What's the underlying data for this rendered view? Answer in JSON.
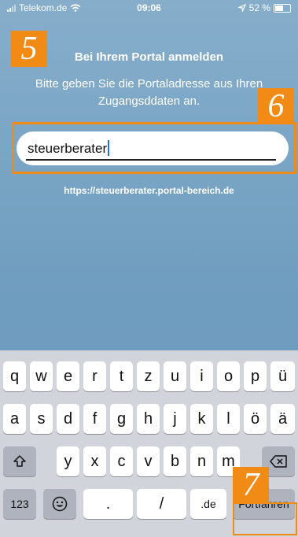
{
  "status_bar": {
    "carrier": "Telekom.de",
    "time": "09:06",
    "battery": "52 %"
  },
  "badges": {
    "step5": "5",
    "step6": "6",
    "step7": "7"
  },
  "login": {
    "title": "Bei Ihrem Portal anmelden",
    "subtitle": "Bitte geben Sie die Portaladresse aus Ihren Zugangsddaten an.",
    "input_value": "steuerberater",
    "url_preview": "https://steuerberater.portal-bereich.de"
  },
  "keyboard": {
    "row1": [
      "q",
      "w",
      "e",
      "r",
      "t",
      "z",
      "u",
      "i",
      "o",
      "p",
      "ü"
    ],
    "row2": [
      "a",
      "s",
      "d",
      "f",
      "g",
      "h",
      "j",
      "k",
      "l",
      "ö",
      "ä"
    ],
    "row3": [
      "y",
      "x",
      "c",
      "v",
      "b",
      "n",
      "m"
    ],
    "numbers_key": "123",
    "period_key": ".",
    "slash_key": "/",
    "domain_key": ".de",
    "continue_key": "Fortfahren"
  },
  "colors": {
    "accent_badge": "#f28a16",
    "background": "#7aa6c8",
    "caret": "#1a73d9"
  }
}
